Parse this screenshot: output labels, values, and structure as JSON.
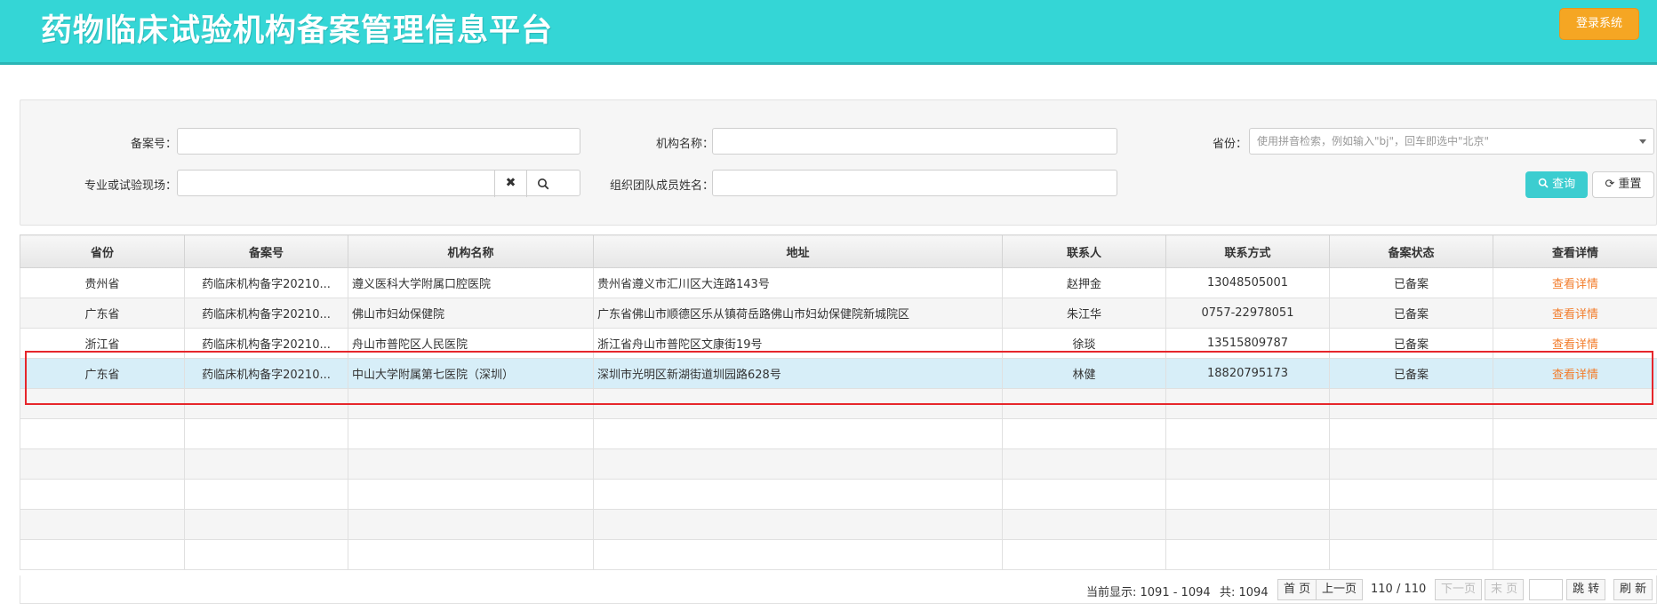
{
  "header": {
    "title": "药物临床试验机构备案管理信息平台",
    "login_label": "登录系统"
  },
  "search": {
    "record_no_label": "备案号：",
    "org_name_label": "机构名称：",
    "province_label": "省份：",
    "province_placeholder": "使用拼音检索，例如输入\"bj\"，回车即选中\"北京\"",
    "specialty_label": "专业或试验现场：",
    "team_member_label": "组织团队成员姓名：",
    "clear_icon": "✖",
    "query_label": "查询",
    "reset_label": "重置"
  },
  "table": {
    "columns": [
      "省份",
      "备案号",
      "机构名称",
      "地址",
      "联系人",
      "联系方式",
      "备案状态",
      "查看详情"
    ],
    "rows": [
      {
        "province": "贵州省",
        "record_no": "药临床机构备字20210...",
        "org": "遵义医科大学附属口腔医院",
        "address": "贵州省遵义市汇川区大连路143号",
        "contact": "赵押金",
        "phone": "13048505001",
        "status": "已备案",
        "detail": "查看详情"
      },
      {
        "province": "广东省",
        "record_no": "药临床机构备字20210...",
        "org": "佛山市妇幼保健院",
        "address": "广东省佛山市顺德区乐从镇荷岳路佛山市妇幼保健院新城院区",
        "contact": "朱江华",
        "phone": "0757-22978051",
        "status": "已备案",
        "detail": "查看详情"
      },
      {
        "province": "浙江省",
        "record_no": "药临床机构备字20210...",
        "org": "舟山市普陀区人民医院",
        "address": "浙江省舟山市普陀区文康街19号",
        "contact": "徐琰",
        "phone": "13515809787",
        "status": "已备案",
        "detail": "查看详情"
      },
      {
        "province": "广东省",
        "record_no": "药临床机构备字20210...",
        "org": "中山大学附属第七医院（深圳）",
        "address": "深圳市光明区新湖街道圳园路628号",
        "contact": "林健",
        "phone": "18820795173",
        "status": "已备案",
        "detail": "查看详情"
      }
    ]
  },
  "pager": {
    "current_display": "当前显示: 1091 - 1094",
    "total": "共: 1094",
    "first": "首 页",
    "prev": "上一页",
    "page_info": "110 / 110",
    "next": "下一页",
    "last": "末 页",
    "jump": "跳 转",
    "refresh": "刷 新"
  },
  "colors": {
    "header_bg": "#34d6d6",
    "login_btn": "#f5a623",
    "query_btn": "#3ccdd0",
    "detail_link": "#f27d2c",
    "selected_row": "#d7eef8",
    "highlight_box": "#e6262b"
  }
}
